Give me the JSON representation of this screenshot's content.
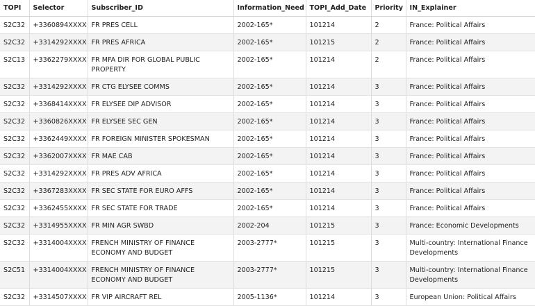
{
  "table": {
    "columns": [
      "TOPI",
      "Selector",
      "Subscriber_ID",
      "Information_Need",
      "TOPI_Add_Date",
      "Priority",
      "IN_Explainer"
    ],
    "rows": [
      [
        "S2C32",
        "+3360894XXXX",
        "FR PRES CELL",
        "2002-165*",
        "101214",
        "2",
        "France: Political Affairs"
      ],
      [
        "S2C32",
        "+3314292XXXX",
        "FR PRES AFRICA",
        "2002-165*",
        "101215",
        "2",
        "France: Political Affairs"
      ],
      [
        "S2C13",
        "+3362279XXXX",
        "FR MFA DIR FOR GLOBAL PUBLIC PROPERTY",
        "2002-165*",
        "101214",
        "2",
        "France: Political Affairs"
      ],
      [
        "S2C32",
        "+3314292XXXX",
        "FR CTG ELYSEE COMMS",
        "2002-165*",
        "101214",
        "3",
        "France: Political Affairs"
      ],
      [
        "S2C32",
        "+3368414XXXX",
        "FR ELYSEE DIP ADVISOR",
        "2002-165*",
        "101214",
        "3",
        "France: Political Affairs"
      ],
      [
        "S2C32",
        "+3360826XXXX",
        "FR ELYSEE SEC GEN",
        "2002-165*",
        "101214",
        "3",
        "France: Political Affairs"
      ],
      [
        "S2C32",
        "+3362449XXXX",
        "FR FOREIGN MINISTER SPOKESMAN",
        "2002-165*",
        "101214",
        "3",
        "France: Political Affairs"
      ],
      [
        "S2C32",
        "+3362007XXXX",
        "FR MAE CAB",
        "2002-165*",
        "101214",
        "3",
        "France: Political Affairs"
      ],
      [
        "S2C32",
        "+3314292XXXX",
        "FR PRES ADV AFRICA",
        "2002-165*",
        "101214",
        "3",
        "France: Political Affairs"
      ],
      [
        "S2C32",
        "+3367283XXXX",
        "FR SEC STATE FOR EURO AFFS",
        "2002-165*",
        "101214",
        "3",
        "France: Political Affairs"
      ],
      [
        "S2C32",
        "+3362455XXXX",
        "FR SEC STATE FOR TRADE",
        "2002-165*",
        "101214",
        "3",
        "France: Political Affairs"
      ],
      [
        "S2C32",
        "+3314955XXXX",
        "FR MIN AGR SWBD",
        "2002-204",
        "101215",
        "3",
        "France: Economic Developments"
      ],
      [
        "S2C32",
        "+3314004XXXX",
        "FRENCH MINISTRY OF FINANCE ECONOMY AND BUDGET",
        "2003-2777*",
        "101215",
        "3",
        "Multi-country: International Finance Developments"
      ],
      [
        "S2C51",
        "+3314004XXXX",
        "FRENCH MINISTRY OF FINANCE ECONOMY AND BUDGET",
        "2003-2777*",
        "101215",
        "3",
        "Multi-country: International Finance Developments"
      ],
      [
        "S2C32",
        "+3314507XXXX",
        "FR VIP AIRCRAFT REL",
        "2005-1136*",
        "101214",
        "3",
        "European Union: Political Affairs"
      ]
    ]
  }
}
